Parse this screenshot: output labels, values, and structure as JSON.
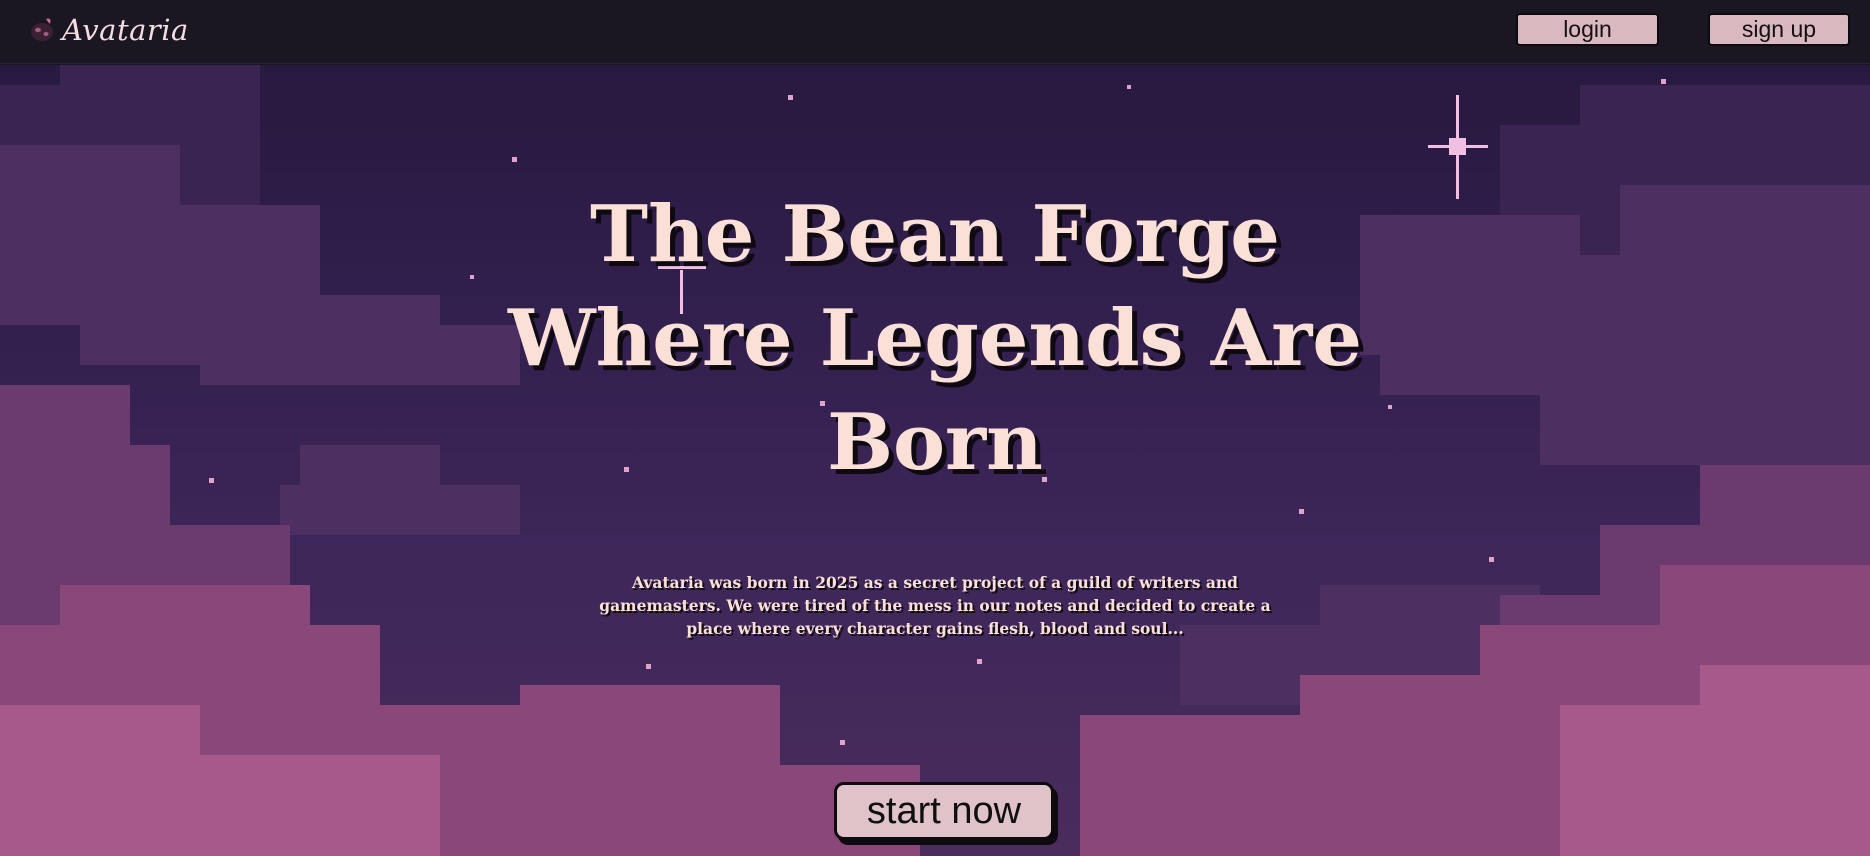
{
  "header": {
    "brand": "Avataria",
    "logo_icon": "bean-icon",
    "login_label": "login",
    "signup_label": "sign up"
  },
  "hero": {
    "title_line_1": "The Bean Forge",
    "title_line_2": "Where Legends Are",
    "title_line_3": "Born",
    "intro": "Avataria was born in 2025 as a secret project of a guild of writers and gamemasters. We were tired of the mess in our notes and decided to create a place where every character gains flesh, blood and soul...",
    "cta_label": "start now"
  },
  "colors": {
    "header_bg": "#1a1622",
    "sky_top": "#27193f",
    "sky_bottom": "#4a2c5d",
    "cloud_dark": "#5a3465",
    "cloud_pink": "#a35a85",
    "text": "#fbe0d8",
    "button_bg": "#d9b8bf"
  }
}
